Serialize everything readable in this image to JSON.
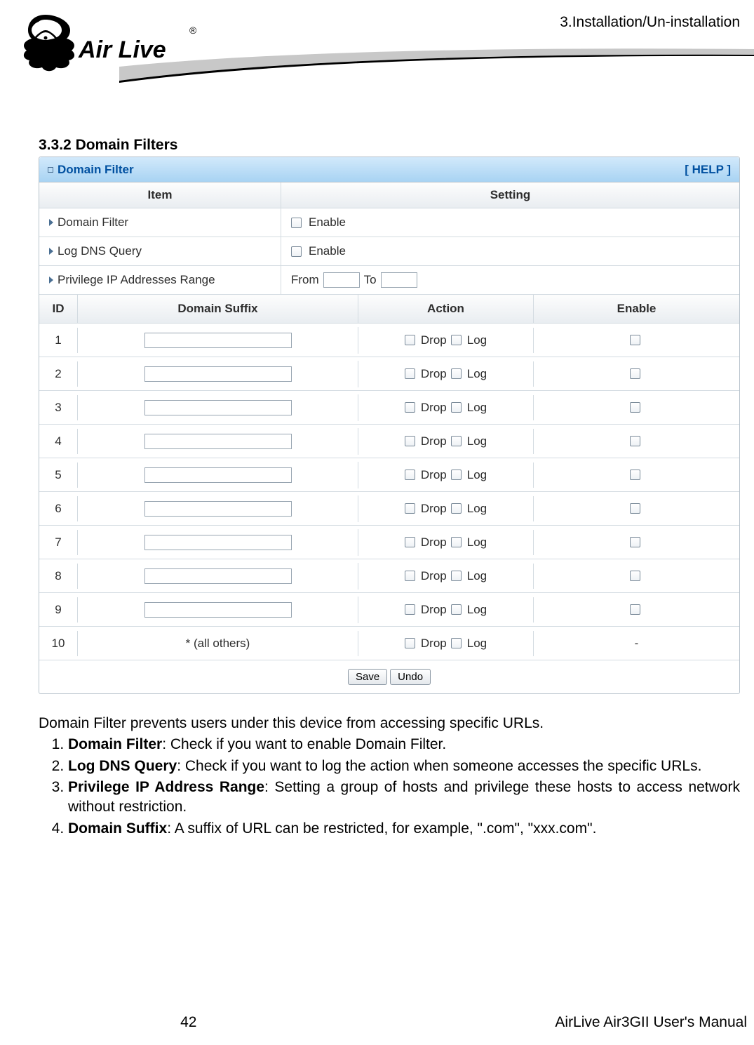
{
  "header": {
    "breadcrumb": "3.Installation/Un-installation",
    "logo_name": "Air Live",
    "logo_trademark": "®"
  },
  "section": {
    "number": "3.3.2",
    "title": "Domain Filters"
  },
  "panel": {
    "title": "Domain Filter",
    "help_link": "[ HELP ]",
    "settings_header": {
      "item": "Item",
      "setting": "Setting"
    },
    "settings": [
      {
        "label": "Domain Filter",
        "type": "checkbox",
        "text": "Enable",
        "checked": false
      },
      {
        "label": "Log DNS Query",
        "type": "checkbox",
        "text": "Enable",
        "checked": false
      },
      {
        "label": "Privilege IP Addresses Range",
        "type": "range",
        "from_label": "From",
        "to_label": "To",
        "from": "",
        "to": ""
      }
    ],
    "grid_header": {
      "id": "ID",
      "domain_suffix": "Domain Suffix",
      "action": "Action",
      "enable": "Enable"
    },
    "action_labels": {
      "drop": "Drop",
      "log": "Log"
    },
    "rows": [
      {
        "id": "1",
        "suffix": "",
        "drop": false,
        "log": false,
        "enable": false,
        "last": false
      },
      {
        "id": "2",
        "suffix": "",
        "drop": false,
        "log": false,
        "enable": false,
        "last": false
      },
      {
        "id": "3",
        "suffix": "",
        "drop": false,
        "log": false,
        "enable": false,
        "last": false
      },
      {
        "id": "4",
        "suffix": "",
        "drop": false,
        "log": false,
        "enable": false,
        "last": false
      },
      {
        "id": "5",
        "suffix": "",
        "drop": false,
        "log": false,
        "enable": false,
        "last": false
      },
      {
        "id": "6",
        "suffix": "",
        "drop": false,
        "log": false,
        "enable": false,
        "last": false
      },
      {
        "id": "7",
        "suffix": "",
        "drop": false,
        "log": false,
        "enable": false,
        "last": false
      },
      {
        "id": "8",
        "suffix": "",
        "drop": false,
        "log": false,
        "enable": false,
        "last": false
      },
      {
        "id": "9",
        "suffix": "",
        "drop": false,
        "log": false,
        "enable": false,
        "last": false
      },
      {
        "id": "10",
        "suffix_label": "* (all others)",
        "drop": false,
        "log": false,
        "enable_label": "-",
        "last": true
      }
    ],
    "buttons": {
      "save": "Save",
      "undo": "Undo"
    }
  },
  "body": {
    "intro": "Domain Filter prevents users under this device from accessing specific URLs.",
    "items": [
      {
        "b": "Domain Filter",
        "t": ": Check if you want to enable Domain Filter."
      },
      {
        "b": "Log DNS Query",
        "t": ": Check if you want to log the action when someone accesses the specific URLs."
      },
      {
        "b": "Privilege IP Address Range",
        "t": ": Setting a group of hosts and privilege these hosts to access network without restriction."
      },
      {
        "b": "Domain Suffix",
        "t": ": A suffix of URL can be restricted, for example, \".com\", \"xxx.com\"."
      }
    ]
  },
  "footer": {
    "page": "42",
    "manual": "AirLive Air3GII User's Manual"
  }
}
